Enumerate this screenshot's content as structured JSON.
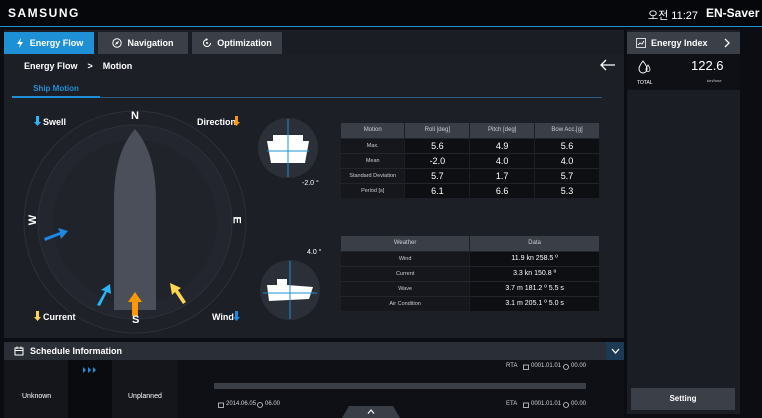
{
  "header": {
    "brand": "SAMSUNG",
    "time": "오전 11:27",
    "app_name": "EN-Saver"
  },
  "tabs": [
    {
      "label": "Energy Flow",
      "icon": "bolt-icon",
      "active": true
    },
    {
      "label": "Navigation",
      "icon": "compass-icon",
      "active": false
    },
    {
      "label": "Optimization",
      "icon": "refresh-icon",
      "active": false
    }
  ],
  "breadcrumb": {
    "root": "Energy Flow",
    "sep": ">",
    "current": "Motion"
  },
  "subtab": {
    "label": "Ship Motion"
  },
  "compass": {
    "north": "N",
    "south": "S",
    "east": "E",
    "west": "W",
    "swell_label": "Swell",
    "direction_label": "Direction",
    "current_label": "Current",
    "wind_label": "Wind"
  },
  "attitude": {
    "roll_value": "-2.0 °",
    "pitch_value": "4.0 °"
  },
  "motion_table": {
    "headers": [
      "Motion",
      "Roll [deg]",
      "Pitch [deg]",
      "Bow Acc.[g]"
    ],
    "rows": [
      {
        "label": "Max.",
        "roll": "5.6",
        "pitch": "4.9",
        "bow": "5.6"
      },
      {
        "label": "Mean",
        "roll": "-2.0",
        "pitch": "4.0",
        "bow": "4.0"
      },
      {
        "label": "Standard Deviation",
        "roll": "5.7",
        "pitch": "1.7",
        "bow": "5.7"
      },
      {
        "label": "Period [s]",
        "roll": "6.1",
        "pitch": "6.6",
        "bow": "5.3"
      }
    ]
  },
  "weather_table": {
    "headers": [
      "Weather",
      "Data"
    ],
    "rows": [
      {
        "label": "Wind",
        "value": "11.9 kn  258.5 º"
      },
      {
        "label": "Current",
        "value": "3.3 kn  150.8 º"
      },
      {
        "label": "Wave",
        "value": "3.7 m  181.2 º  5.5 s"
      },
      {
        "label": "Air Condition",
        "value": "3.1 m  205.1 º  5.0 s"
      }
    ]
  },
  "schedule": {
    "title": "Schedule Information",
    "from": "Unknown",
    "to": "Unplanned",
    "rta_label": "RTA",
    "rta_date": "0001.01.01",
    "rta_time": "00.00",
    "eta_label": "ETA",
    "eta_date": "0001.01.01",
    "eta_time": "00.00",
    "departure_date": "2014.06.05",
    "departure_time": "06.00"
  },
  "energy_index": {
    "title": "Energy Index",
    "total_label": "TOTAL",
    "value": "122.6",
    "unit": "ton/hour"
  },
  "setting_label": "Setting",
  "colors": {
    "accent": "#1e90d6",
    "swell": "#29b6f6",
    "current": "#ffd54f",
    "wind": "#1e88e5",
    "direction": "#ff9800"
  }
}
